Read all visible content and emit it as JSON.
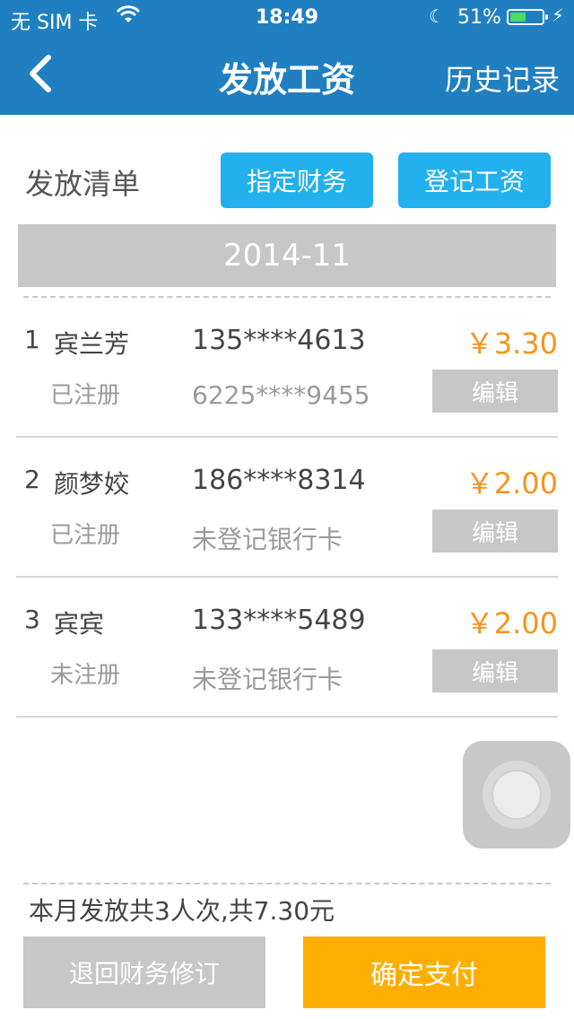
{
  "status_bar": {
    "carrier": "无 SIM 卡",
    "time": "18:49",
    "battery_percent": "51%",
    "battery_level": 0.51,
    "battery_color": "#4cd964"
  },
  "nav": {
    "title": "发放工资",
    "right_label": "历史记录",
    "bg_color": "#1f7fc1"
  },
  "toolbar": {
    "list_title": "发放清单",
    "assign_label": "指定财务",
    "register_label": "登记工资",
    "button_color": "#22b0ee"
  },
  "month": "2014-11",
  "payees": [
    {
      "index": "1",
      "name": "宾兰芳",
      "phone": "135****4613",
      "amount": "￥3.30",
      "status": "已注册",
      "card": "6225****9455",
      "edit_label": "编辑"
    },
    {
      "index": "2",
      "name": "颜梦姣",
      "phone": "186****8314",
      "amount": "￥2.00",
      "status": "已注册",
      "card": "未登记银行卡",
      "edit_label": "编辑"
    },
    {
      "index": "3",
      "name": "宾宾",
      "phone": "133****5489",
      "amount": "￥2.00",
      "status": "未注册",
      "card": "未登记银行卡",
      "edit_label": "编辑"
    }
  ],
  "footer": {
    "summary": "本月发放共3人次,共7.30元",
    "back_label": "退回财务修订",
    "pay_label": "确定支付",
    "pay_color": "#ffae00"
  },
  "icons": {
    "back": "chevron-left-icon",
    "wifi": "wifi-icon",
    "moon": "moon-icon",
    "battery": "battery-icon",
    "charging": "bolt-icon",
    "assistive": "assistive-touch-icon"
  }
}
